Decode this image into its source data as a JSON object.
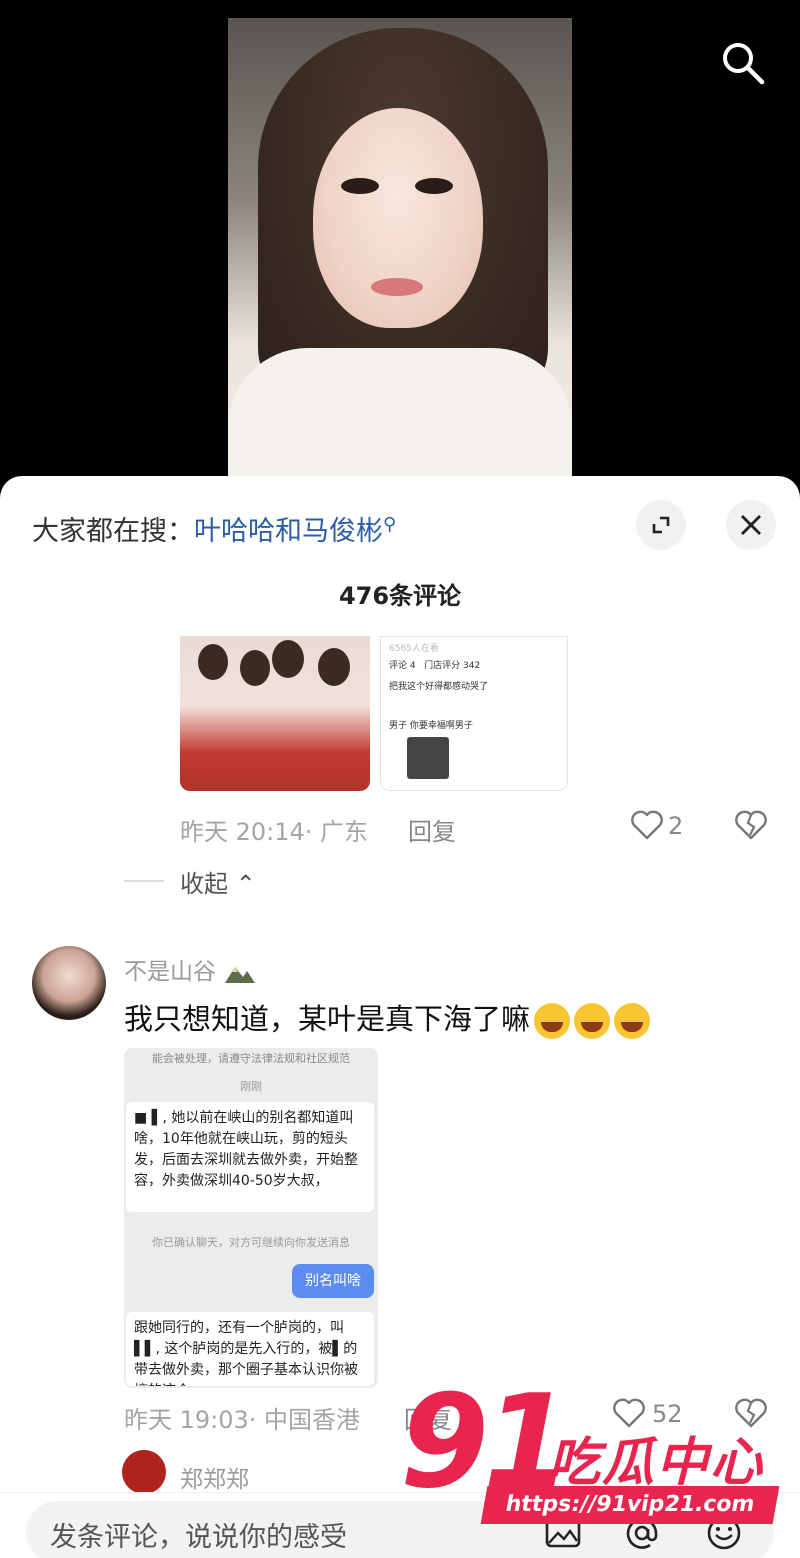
{
  "video": {
    "search_icon": "search-icon"
  },
  "header": {
    "hot_prefix": "大家都在搜：",
    "hot_keyword": "叶哈哈和马俊彬",
    "comment_count": "476条评论"
  },
  "comment1": {
    "time_loc": "昨天 20:14· 广东",
    "reply": "回复",
    "likes": "2",
    "collapse": "收起"
  },
  "comment2": {
    "username": "不是山谷",
    "text": "我只想知道，某叶是真下海了嘛",
    "shot": {
      "header": "能会被处理，请遵守法律法规和社区规范",
      "time": "刚刚",
      "message": "■ ▌, 她以前在峡山的别名都知道叫啥，10年他就在峡山玩，剪的短头发，后面去深圳就去做外卖，开始整容，外卖做深圳40-50岁大叔，",
      "system": "你已确认聊天，对方可继续向你发送消息",
      "reply": "别名叫啥",
      "message2": "跟她同行的，还有一个胪岗的，叫▌▌, 这个胪岗的是先入行的，被▌的带去做外卖，那个圈子基本认识你被搞的这个"
    },
    "time_loc": "昨天 19:03· 中国香港",
    "reply": "回复",
    "likes": "52"
  },
  "comment3": {
    "username": "郑郑郑"
  },
  "input": {
    "placeholder": "发条评论，说说你的感受"
  },
  "watermark": {
    "num": "91",
    "title": "吃瓜中心",
    "url": "https://91vip21.com"
  }
}
